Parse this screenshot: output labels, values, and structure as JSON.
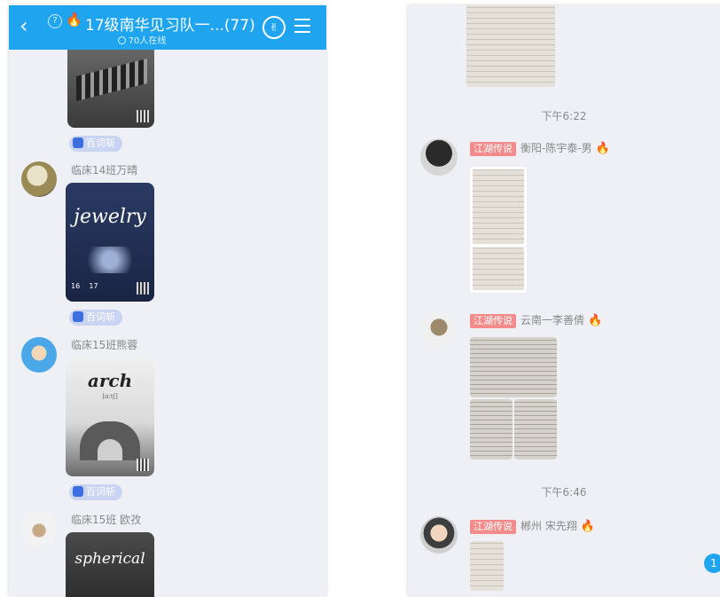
{
  "left": {
    "header": {
      "back_icon": "‹",
      "title": "17级南华见习队一...",
      "member_count": "(77)",
      "online_text": "70人在线"
    },
    "cards": [
      {
        "app_badge": "百词斩"
      },
      {
        "word": "jewelry",
        "app_badge": "百词斩"
      },
      {
        "word": "arch",
        "sub": "[ɑ:tʃ]",
        "app_badge": "百词斩"
      },
      {
        "word": "spherical"
      }
    ],
    "members": [
      {
        "name": "临床14班万晴"
      },
      {
        "name": "临床15班熊蓉"
      },
      {
        "name": "临床15班 欧孜"
      }
    ]
  },
  "right": {
    "times": [
      "下午6:22",
      "下午6:46"
    ],
    "messages": [
      {
        "tag": "江湖传说",
        "name": "衡阳-陈宇泰-男"
      },
      {
        "tag": "江湖传说",
        "name": "云南一李善倩"
      },
      {
        "tag": "江湖传说",
        "name": "郴州 宋先翔"
      }
    ],
    "unread_count": "1"
  },
  "colors": {
    "header_blue": "#1fa5f0",
    "chat_bg": "#eef0f6",
    "tag_red": "#f48b8b"
  }
}
